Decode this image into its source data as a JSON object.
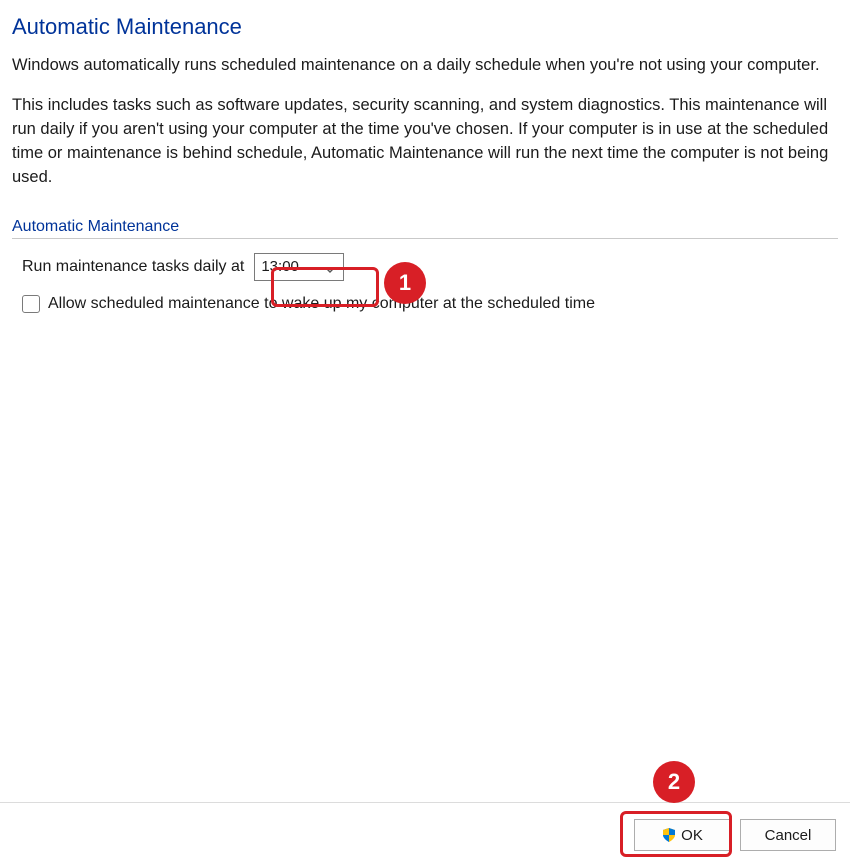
{
  "header": {
    "title": "Automatic Maintenance"
  },
  "description": {
    "para1": "Windows automatically runs scheduled maintenance on a daily schedule when you're not using your computer.",
    "para2": "This includes tasks such as software updates, security scanning, and system diagnostics. This maintenance will run daily if you aren't using your computer at the time you've chosen. If your computer is in use at the scheduled time or maintenance is behind schedule, Automatic Maintenance will run the next time the computer is not being used."
  },
  "group": {
    "legend": "Automatic Maintenance",
    "schedule_label": "Run maintenance tasks daily at",
    "schedule_value": "13:00",
    "wake_checkbox_label": "Allow scheduled maintenance to wake up my computer at the scheduled time",
    "wake_checked": false
  },
  "footer": {
    "ok_label": "OK",
    "cancel_label": "Cancel"
  },
  "annotations": {
    "marker1": "1",
    "marker2": "2"
  },
  "colors": {
    "heading": "#003399",
    "annotation": "#d81f26"
  }
}
